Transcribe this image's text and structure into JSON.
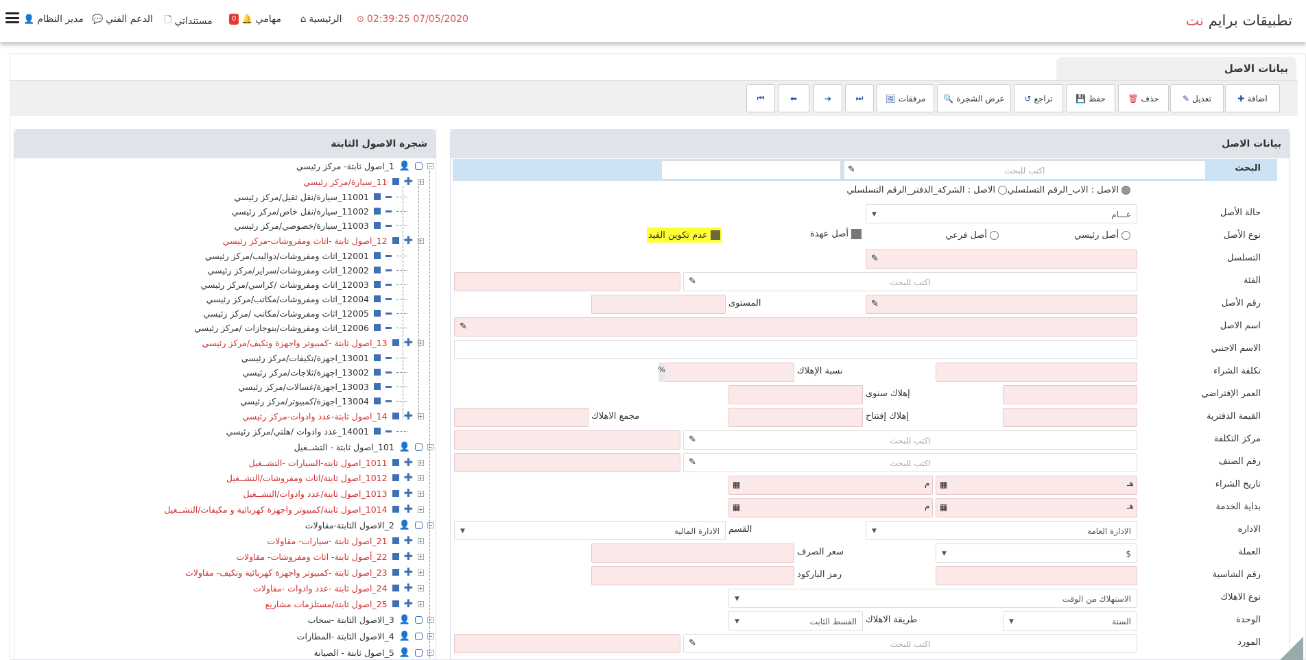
{
  "header": {
    "brand_main": "تطبيقات برايم",
    "brand_accent": "نت",
    "datetime": "07/05/2020 02:39:25",
    "home": "الرئيسية",
    "tasks": "مهامي",
    "tasks_count": "0",
    "docs": "مستنداتي",
    "support": "الدعم الفني",
    "user": "مدير النظام"
  },
  "page": {
    "tab_title": "بيانات الاصل"
  },
  "toolbar": {
    "add": "اضافة",
    "edit": "تعديل",
    "delete": "حذف",
    "save": "حفظ",
    "undo": "تراجع",
    "show_tree": "عرض الشجرة",
    "attachments": "مرفقات"
  },
  "tree": {
    "title": "شجرة الاصول الثابتة",
    "nodes": [
      {
        "label": "1_اصول ثابتة- مركز رئيسي",
        "red": false
      },
      {
        "label": "11_سيارة/مركز رئيسي",
        "red": true
      },
      {
        "label": "11001_سيارة/نقل ثقيل/مركز رئيسي",
        "red": false
      },
      {
        "label": "11002_سيارة/نقل خاص/مركز رئيسي",
        "red": false
      },
      {
        "label": "11003_سيارة/خصوصي/مركز رئيسي",
        "red": false
      },
      {
        "label": "12_اصول ثابتة -اثاث ومفروشات-مركز رئيسي",
        "red": true
      },
      {
        "label": "12001_اثاث ومفروشات/دواليب/مركز رئيسي",
        "red": false
      },
      {
        "label": "12002_اثاث ومفروشات/سراير/مركز رئيسي",
        "red": false
      },
      {
        "label": "12003_اثاث ومفروشات /كراسي/مركز رئيسي",
        "red": false
      },
      {
        "label": "12004_اثاث ومفروشات/مكاتب/مركز رئيسي",
        "red": false
      },
      {
        "label": "12005_اثاث ومفروشات/مكاتب /مركز رئيسي",
        "red": false
      },
      {
        "label": "12006_اثاث ومفروشات/بنوجازات /مركز رئيسي",
        "red": false
      },
      {
        "label": "13_اصول ثابتة -كمبيوتر واجهزة وتكيف/مركز رئيسي",
        "red": true
      },
      {
        "label": "13001_اجهزة/تكيفات/مركز رئيسي",
        "red": false
      },
      {
        "label": "13002_اجهزة/ثلاجات/مركز رئيسي",
        "red": false
      },
      {
        "label": "13003_اجهزة/غسالات/مركز رئيسي",
        "red": false
      },
      {
        "label": "13004_اجهزة/كمبيوتر/مركز رئيسي",
        "red": false
      },
      {
        "label": "14_اصول ثابتة-عدد وادوات-مركز رئيسي",
        "red": true
      },
      {
        "label": "14001_عدد وادوات /هلتي/مركز رئيسي",
        "red": false
      },
      {
        "label": "101_اصول ثابتة - التشــغيل",
        "red": false
      },
      {
        "label": "1011_اصول ثابته-السيارات -التشــغيل",
        "red": true
      },
      {
        "label": "1012_اصول ثابتة/اثاث ومفروشات/التشــغيل",
        "red": true
      },
      {
        "label": "1013_اصول ثابتة/عدد وادوات/التشــغيل",
        "red": true
      },
      {
        "label": "1014_اصول ثابتة/كمبيوتر واجهزة كهربائية و مكيفات/التشــغيل",
        "red": true
      },
      {
        "label": "2_الاصول الثابتة-مقاولات",
        "red": false
      },
      {
        "label": "21_اصول ثابتة -سيارات- مقاولات",
        "red": true
      },
      {
        "label": "22_أصول ثابتة- اثاث ومفروشات- مقاولات",
        "red": true
      },
      {
        "label": "23_اصول ثابتة -كمبيوتر واجهزة كهربائية وتكيف- مقاولات",
        "red": true
      },
      {
        "label": "24_اصول ثابتة -عدد وادوات -مقاولات",
        "red": true
      },
      {
        "label": "25_اصول ثابتة/مستلزمات مشاريع",
        "red": true
      },
      {
        "label": "3_الاصول الثابتة -سحاب",
        "red": false
      },
      {
        "label": "4_الاصول الثابتة -المطارات",
        "red": false
      },
      {
        "label": "5_اصول ثابتة - الصيانة",
        "red": false
      }
    ]
  },
  "form": {
    "title": "بيانات الاصل",
    "search_label": "البحث",
    "search_placeholder": "اكتب للبحث",
    "radio_parent_serial": "الاصل : الاب_الرقم التسلسلي",
    "radio_company_serial": "الاصل : الشركة_الدفتر_الرقم التسلسلي",
    "status_label": "حالة الأصل",
    "status_value": "عـــام",
    "type_label": "نوع الأصل",
    "type_main": "أصل رئيسي",
    "type_sub": "أصل فرعي",
    "custody": "أصل عهدة",
    "no_entry": "عدم تكوين القيد",
    "serial_label": "التسلسل",
    "category_label": "الفئة",
    "asset_no_label": "رقم الأصل",
    "level_label": "المستوى",
    "asset_name_label": "اسم الاصل",
    "foreign_name_label": "الاسم الاجنبي",
    "purchase_cost_label": "تكلفة الشراء",
    "depr_rate_label": "نسبة الإهلاك",
    "percent": "%",
    "life_label": "العمر الإفتراضي",
    "annual_depr_label": "إهلاك سنوى",
    "book_value_label": "القيمة الدفترية",
    "opening_depr_label": "إهلاك إفتتاح",
    "accum_depr_label": "مجمع الاهلاك",
    "cost_center_label": "مركز التكلفة",
    "item_no_label": "رقم الصنف",
    "purchase_date_label": "تاريخ الشراء",
    "service_start_label": "بداية الخدمة",
    "hijri": "هـ",
    "gregorian": "م",
    "admin_label": "الاداره",
    "admin_value": "الادارة العامة",
    "dept_label": "القسم",
    "dept_value": "الادارة المالية",
    "currency_label": "العملة",
    "currency_value": "$",
    "rate_label": "سعر الصرف",
    "chassis_label": "رقم الشاسية",
    "barcode_label": "رمز الباركود",
    "depr_type_label": "نوع الاهلاك",
    "depr_type_value": "الاستهلاك من الوقت",
    "unit_label": "الوحدة",
    "unit_value": "السنة",
    "depr_method_label": "طريقة الاهلاك",
    "depr_method_value": "القسط الثابت",
    "supplier_label": "المورد"
  },
  "colors": {
    "accent": "#e05a5a",
    "required_bg": "#fbe8e8",
    "highlight": "#ffff33",
    "icon_blue": "#3f6fb5"
  }
}
